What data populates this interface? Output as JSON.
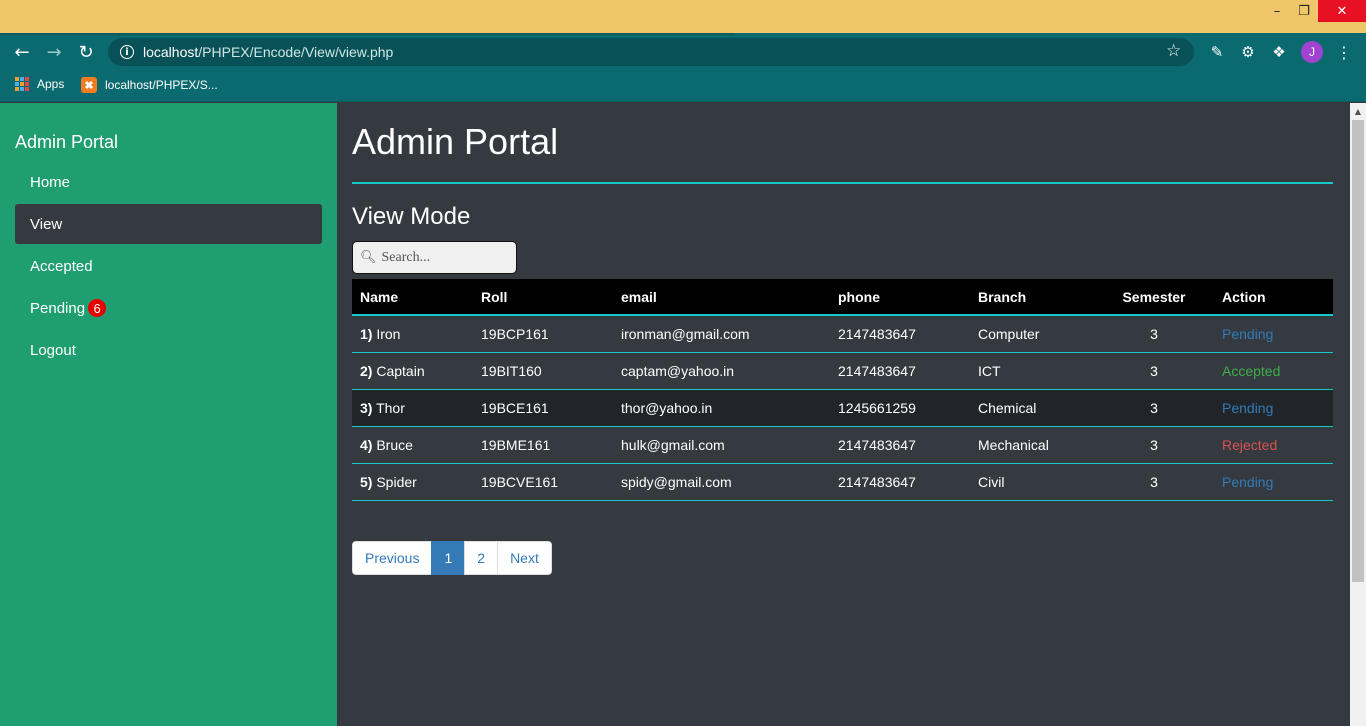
{
  "browser": {
    "url_host": "localhost",
    "url_path": "/PHPEX/Encode/View/view.php",
    "avatar_letter": "J",
    "bookmarks": [
      {
        "label": "Apps",
        "icon": "apps-grid-icon"
      },
      {
        "label": "localhost/PHPEX/S...",
        "icon": "xampp-icon"
      }
    ]
  },
  "sidebar": {
    "title": "Admin Portal",
    "items": [
      {
        "label": "Home"
      },
      {
        "label": "View",
        "active": true
      },
      {
        "label": "Accepted"
      },
      {
        "label": "Pending",
        "badge": "6"
      },
      {
        "label": "Logout"
      }
    ]
  },
  "main": {
    "title": "Admin Portal",
    "subtitle": "View Mode",
    "search_placeholder": "Search...",
    "table": {
      "columns": [
        "Name",
        "Roll",
        "email",
        "phone",
        "Branch",
        "Semester",
        "Action"
      ],
      "rows": [
        {
          "num": "1)",
          "name": "Iron",
          "roll": "19BCP161",
          "email": "ironman@gmail.com",
          "phone": "2147483647",
          "branch": "Computer",
          "semester": "3",
          "action": "Pending"
        },
        {
          "num": "2)",
          "name": "Captain",
          "roll": "19BIT160",
          "email": "captam@yahoo.in",
          "phone": "2147483647",
          "branch": "ICT",
          "semester": "3",
          "action": "Accepted"
        },
        {
          "num": "3)",
          "name": "Thor",
          "roll": "19BCE161",
          "email": "thor@yahoo.in",
          "phone": "1245661259",
          "branch": "Chemical",
          "semester": "3",
          "action": "Pending"
        },
        {
          "num": "4)",
          "name": "Bruce",
          "roll": "19BME161",
          "email": "hulk@gmail.com",
          "phone": "2147483647",
          "branch": "Mechanical",
          "semester": "3",
          "action": "Rejected"
        },
        {
          "num": "5)",
          "name": "Spider",
          "roll": "19BCVE161",
          "email": "spidy@gmail.com",
          "phone": "2147483647",
          "branch": "Civil",
          "semester": "3",
          "action": "Pending"
        }
      ]
    },
    "pagination": {
      "prev": "Previous",
      "pages": [
        "1",
        "2"
      ],
      "current": "1",
      "next": "Next"
    }
  },
  "colors": {
    "sidebar_bg": "#1f9e72",
    "main_bg": "#343a40",
    "accent_line": "#16c8c8",
    "pending": "#337ab7",
    "accepted": "#3fae49",
    "rejected": "#d9534f",
    "badge": "#e80000"
  }
}
